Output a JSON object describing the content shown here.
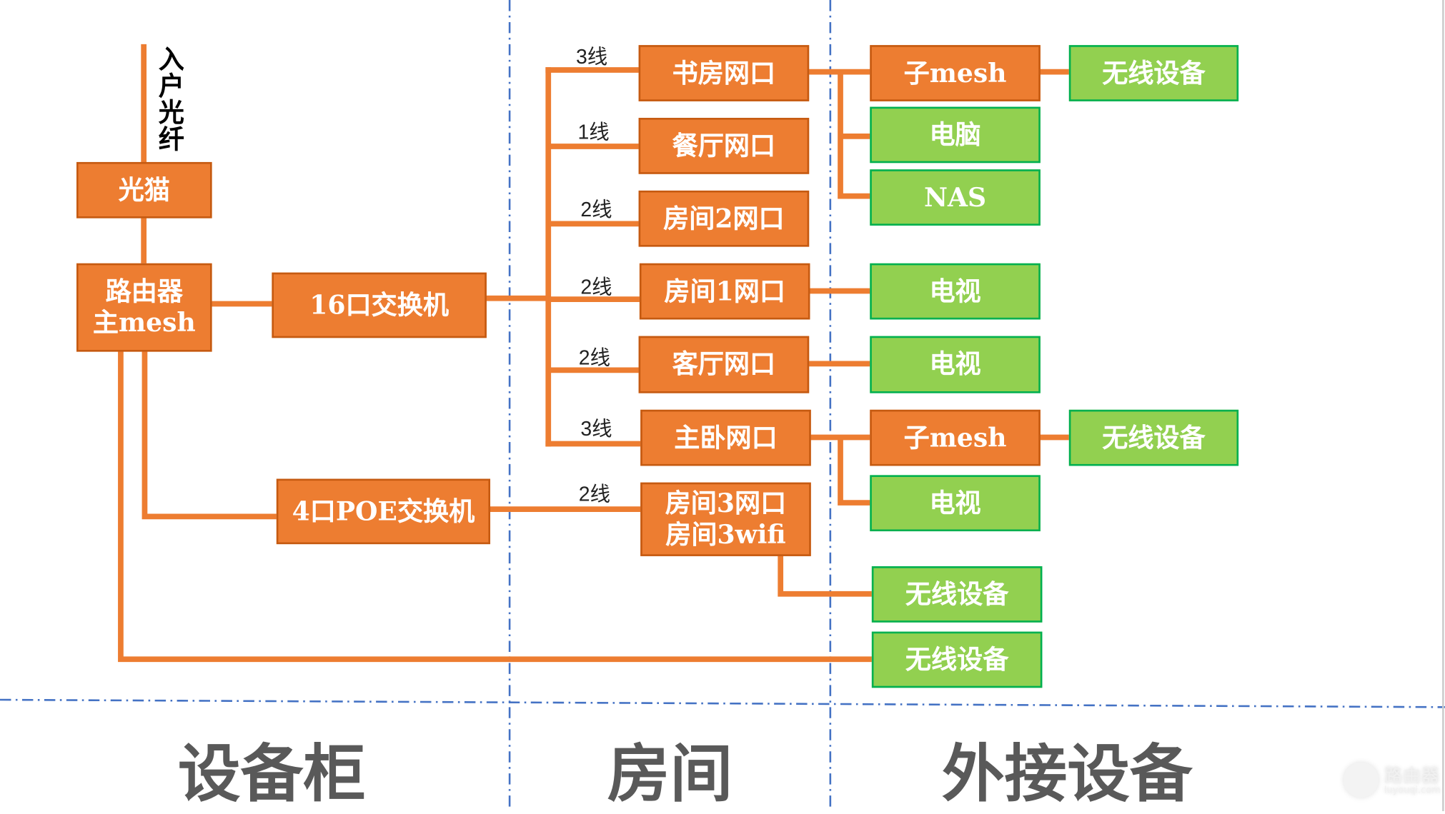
{
  "fiber_label": "入户光纤",
  "nodes": {
    "modem": "光猫",
    "router_l1": "路由器",
    "router_l2": "主mesh",
    "switch16": "16口交换机",
    "poe4": "4口POE交换机",
    "study": "书房网口",
    "dining": "餐厅网口",
    "room2": "房间2网口",
    "room1": "房间1网口",
    "living": "客厅网口",
    "master": "主卧网口",
    "room3_l1": "房间3网口",
    "room3_l2": "房间3wifi",
    "submesh1": "子mesh",
    "pc": "电脑",
    "nas": "NAS",
    "tv1": "电视",
    "tv2": "电视",
    "submesh2": "子mesh",
    "tv3": "电视",
    "wireless_room3": "无线设备",
    "wireless_router": "无线设备",
    "wireless_sub1": "无线设备",
    "wireless_sub2": "无线设备"
  },
  "cable_labels": [
    "3线",
    "1线",
    "2线",
    "2线",
    "2线",
    "3线",
    "2线"
  ],
  "sections": [
    "设备柜",
    "房间",
    "外接设备"
  ],
  "watermark": {
    "title": "路由器",
    "url": "luyouqi.com"
  },
  "colors": {
    "core": "#ED7D31",
    "core_border": "#C55A11",
    "device": "#92D050",
    "device_border": "#00B050",
    "divider": "#4472C4",
    "section": "#595959"
  }
}
